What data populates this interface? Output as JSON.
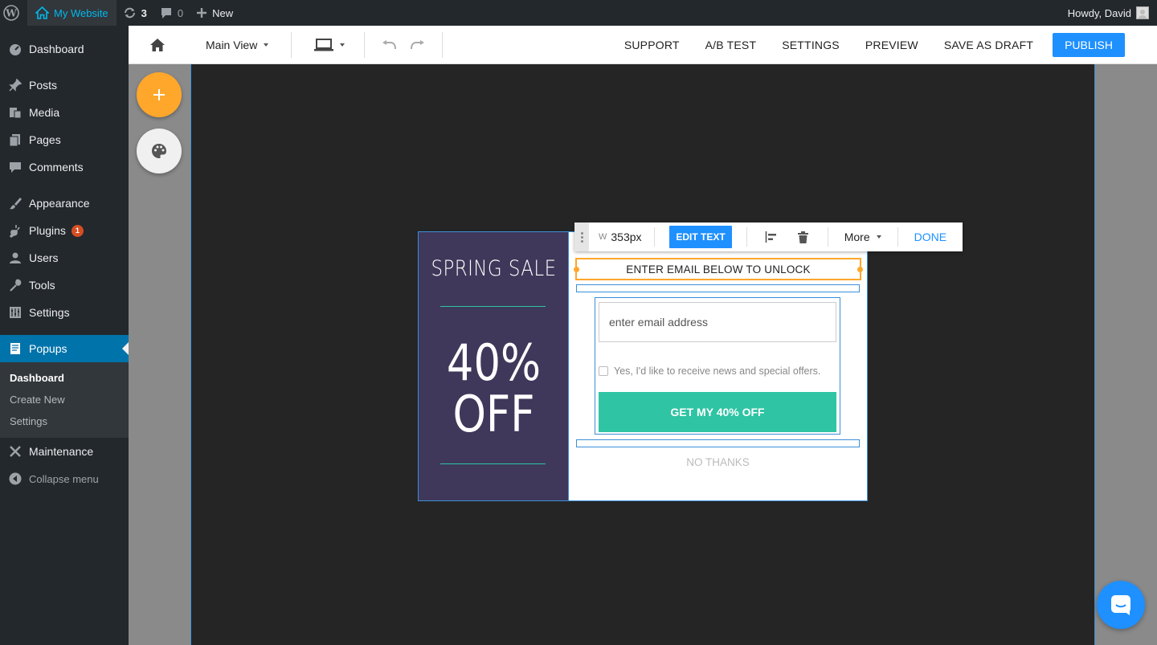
{
  "adminbar": {
    "site_name": "My Website",
    "updates_count": "3",
    "comments_count": "0",
    "new_label": "New",
    "howdy": "Howdy, David"
  },
  "sidebar": {
    "items": [
      {
        "label": "Dashboard",
        "icon": "dashboard-icon"
      },
      {
        "label": "Posts",
        "icon": "pin-icon"
      },
      {
        "label": "Media",
        "icon": "media-icon"
      },
      {
        "label": "Pages",
        "icon": "pages-icon"
      },
      {
        "label": "Comments",
        "icon": "comment-icon"
      },
      {
        "label": "Appearance",
        "icon": "brush-icon"
      },
      {
        "label": "Plugins",
        "icon": "plug-icon",
        "badge": "1"
      },
      {
        "label": "Users",
        "icon": "user-icon"
      },
      {
        "label": "Tools",
        "icon": "wrench-icon"
      },
      {
        "label": "Settings",
        "icon": "sliders-icon"
      },
      {
        "label": "Popups",
        "icon": "popup-icon",
        "active": true
      },
      {
        "label": "Maintenance",
        "icon": "tools-icon"
      }
    ],
    "submenu": [
      "Dashboard",
      "Create New",
      "Settings"
    ],
    "collapse_label": "Collapse menu"
  },
  "toolbar": {
    "view_label": "Main View",
    "support": "SUPPORT",
    "ab_test": "A/B TEST",
    "settings": "SETTINGS",
    "preview": "PREVIEW",
    "save_draft": "SAVE AS DRAFT",
    "publish": "PUBLISH"
  },
  "element_toolbar": {
    "w_label": "W",
    "width_value": "353px",
    "edit_text": "EDIT TEXT",
    "more": "More",
    "done": "DONE"
  },
  "popup": {
    "sale_title": "SPRING SALE",
    "discount_line1": "40%",
    "discount_line2": "OFF",
    "headline": "ENTER EMAIL BELOW TO UNLOCK",
    "email_placeholder": "enter email address",
    "optin_text": "Yes, I'd like to receive news and special offers.",
    "cta": "GET MY 40% OFF",
    "no_thanks": "NO THANKS"
  },
  "colors": {
    "accent_blue": "#1e90ff",
    "popup_panel": "#3f385a",
    "cta_teal": "#2ec4a4",
    "fab_orange": "#ffa72b",
    "wp_active": "#0073aa"
  }
}
